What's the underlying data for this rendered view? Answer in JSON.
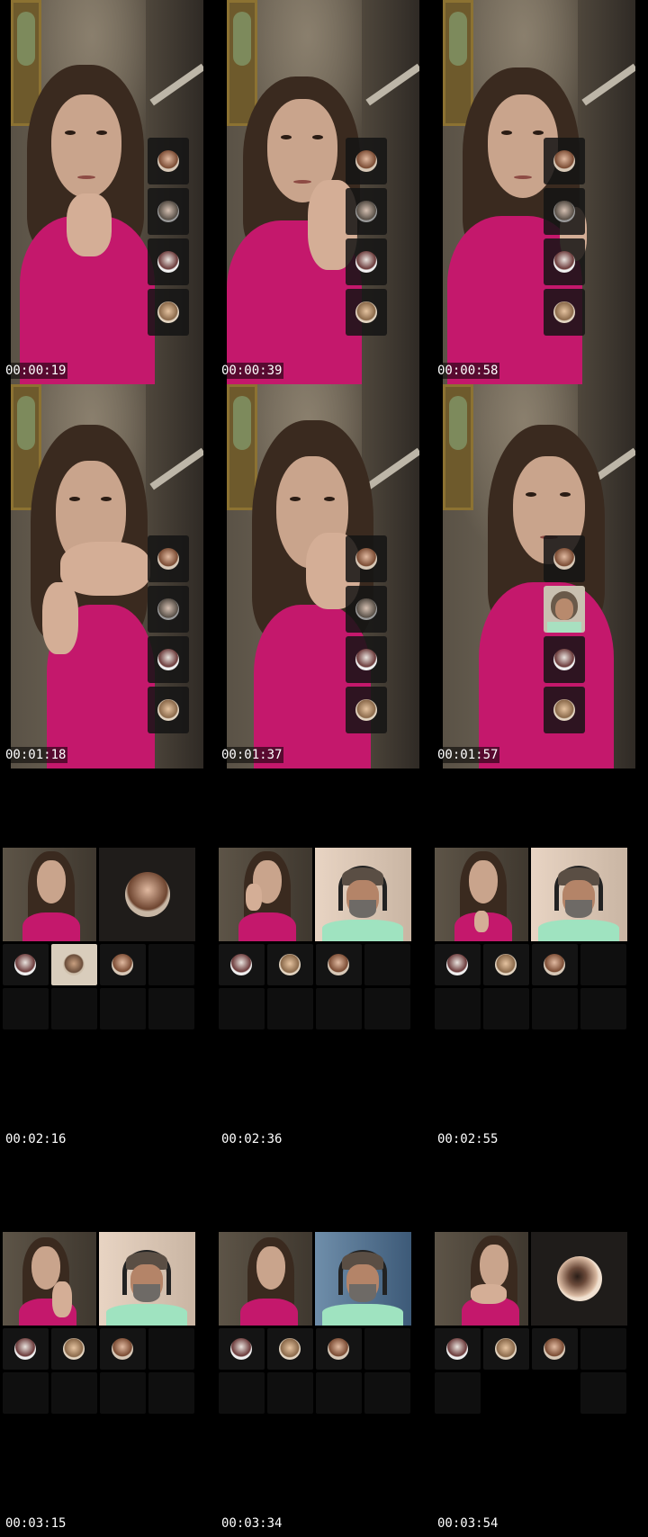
{
  "frames": [
    {
      "timestamp": "00:00:19",
      "layout": "single",
      "strip": [
        "p1",
        "p2",
        "p3",
        "p4"
      ]
    },
    {
      "timestamp": "00:00:39",
      "layout": "single",
      "strip": [
        "p1",
        "p2",
        "p3",
        "p4"
      ]
    },
    {
      "timestamp": "00:00:58",
      "layout": "single",
      "strip": [
        "p1",
        "p2",
        "p3",
        "p4"
      ]
    },
    {
      "timestamp": "00:01:18",
      "layout": "single",
      "strip": [
        "p1",
        "p2",
        "p3",
        "p4"
      ]
    },
    {
      "timestamp": "00:01:37",
      "layout": "single",
      "strip": [
        "p1",
        "p2",
        "p3",
        "p4"
      ]
    },
    {
      "timestamp": "00:01:57",
      "layout": "single",
      "strip": [
        "p1",
        "man",
        "p3",
        "p4"
      ]
    },
    {
      "timestamp": "00:02:16",
      "layout": "grid",
      "top_right": "avatar"
    },
    {
      "timestamp": "00:02:36",
      "layout": "grid",
      "top_right": "man"
    },
    {
      "timestamp": "00:02:55",
      "layout": "grid",
      "top_right": "man"
    },
    {
      "timestamp": "00:03:15",
      "layout": "grid",
      "top_right": "man"
    },
    {
      "timestamp": "00:03:34",
      "layout": "grid",
      "top_right": "man-blue"
    },
    {
      "timestamp": "00:03:54",
      "layout": "grid",
      "top_right": "avatar-eye"
    }
  ],
  "icons": {
    "avatar": "participant-avatar-icon"
  },
  "colors": {
    "background": "#000000",
    "dress": "#c4186c",
    "timestamp_text": "#ffffff"
  }
}
